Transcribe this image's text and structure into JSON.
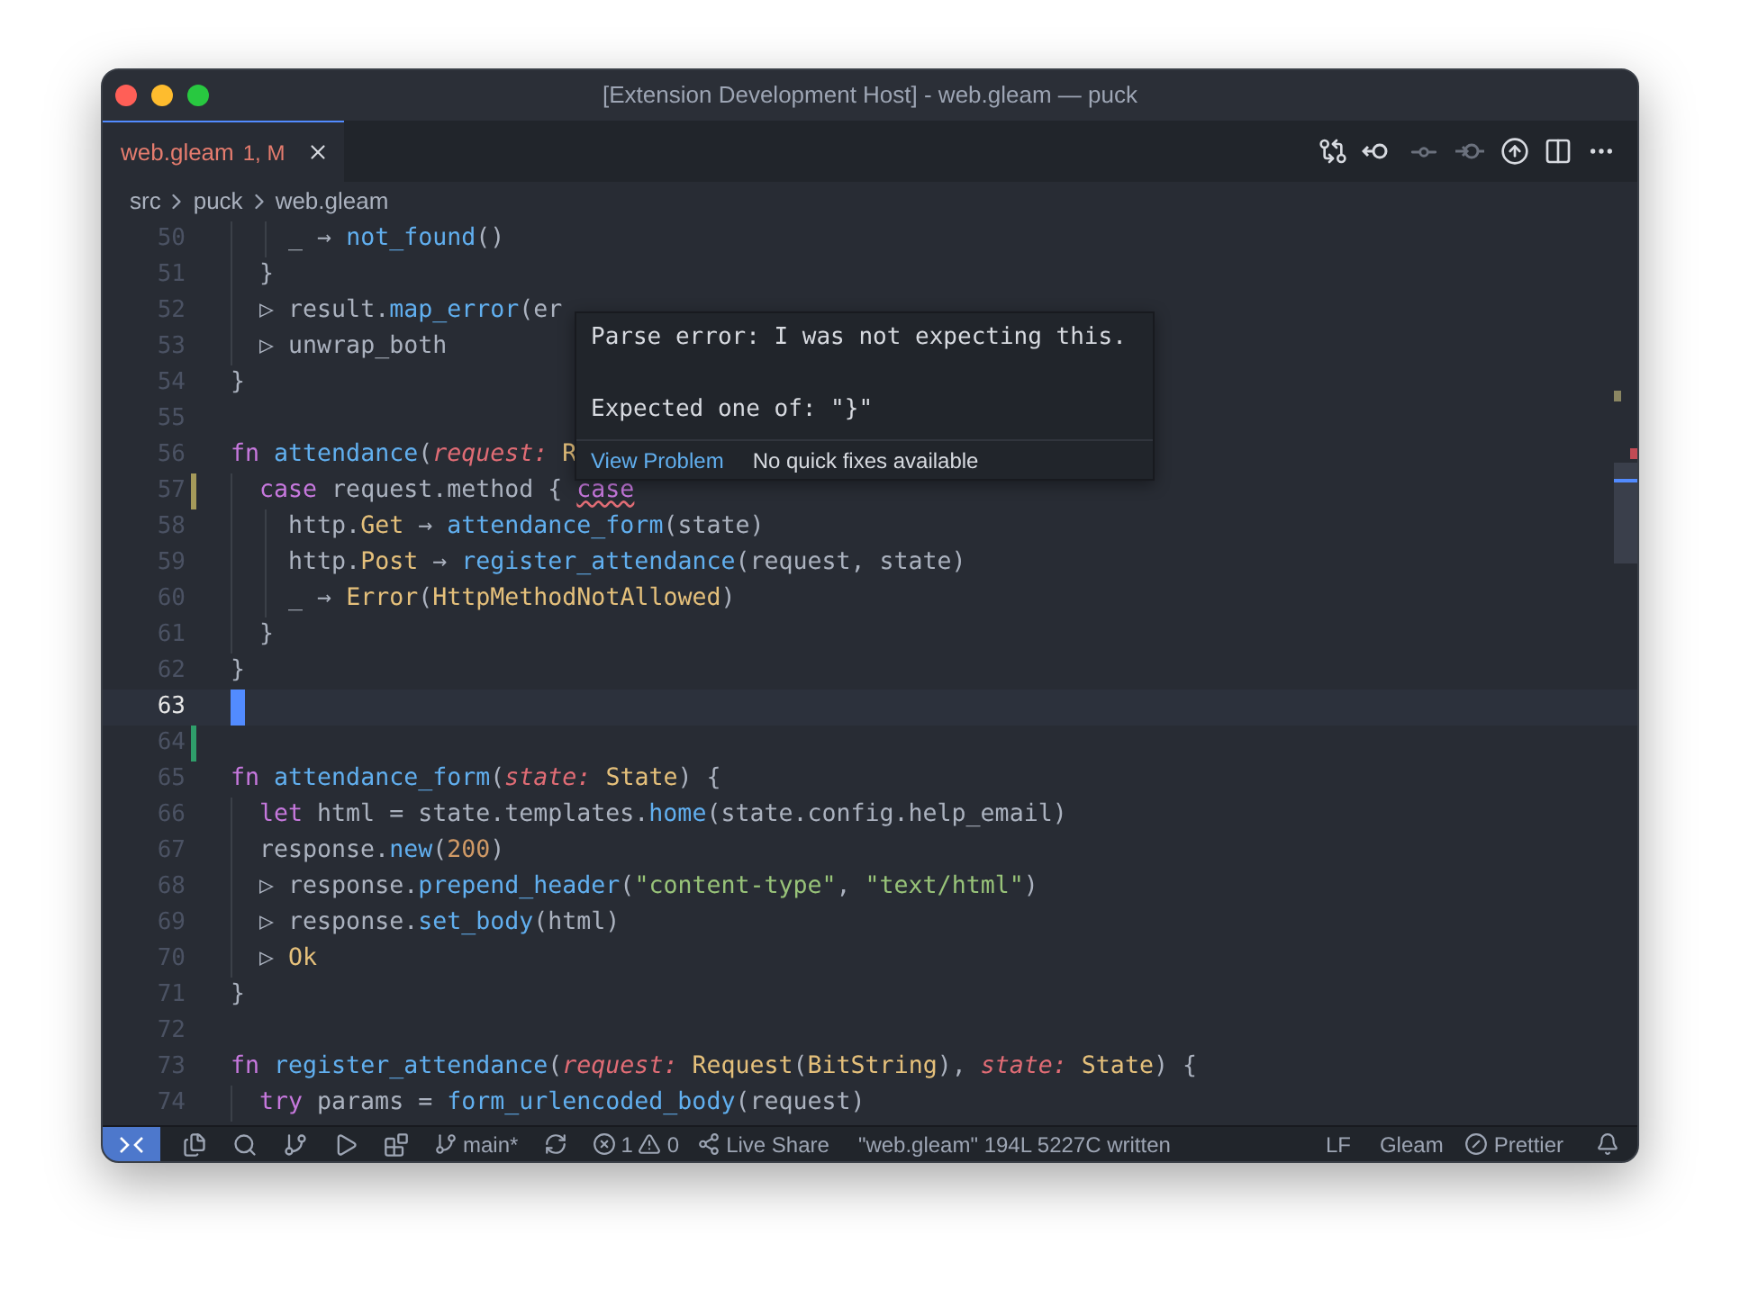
{
  "window": {
    "title": "[Extension Development Host] - web.gleam — puck"
  },
  "tabs": [
    {
      "label": "web.gleam",
      "status": "1, M",
      "selected": true,
      "error": true
    }
  ],
  "editor_actions": [
    {
      "disabled": false
    },
    {
      "disabled": false
    },
    {
      "disabled": true
    },
    {
      "disabled": true
    },
    {
      "disabled": false
    },
    {
      "disabled": false
    },
    {
      "disabled": false
    }
  ],
  "breadcrumbs": [
    "src",
    "puck",
    "web.gleam"
  ],
  "lines": [
    {
      "number": "50",
      "current": false,
      "kind": "plain",
      "tokens": [
        {
          "t": "    _ ",
          "kind": "plain"
        },
        {
          "t": "→",
          "kind": "ligature"
        },
        {
          "t": " not_found",
          "kind": "function"
        },
        {
          "t": "()",
          "kind": "plain"
        }
      ]
    },
    {
      "number": "51",
      "current": false,
      "kind": "plain",
      "tokens": [
        {
          "t": "  }",
          "kind": "plain"
        }
      ]
    },
    {
      "number": "52",
      "current": false,
      "kind": "plain",
      "tokens": [
        {
          "t": "  ▷",
          "kind": "ligature"
        },
        {
          "t": " result.",
          "kind": "plain"
        },
        {
          "t": "map_error",
          "kind": "function"
        },
        {
          "t": "(er",
          "kind": "plain"
        }
      ]
    },
    {
      "number": "53",
      "current": false,
      "kind": "plain",
      "tokens": [
        {
          "t": "  ▷",
          "kind": "ligature"
        },
        {
          "t": " unwrap_both",
          "kind": "plain"
        }
      ]
    },
    {
      "number": "54",
      "current": false,
      "kind": "plain",
      "tokens": [
        {
          "t": "}",
          "kind": "plain"
        }
      ]
    },
    {
      "number": "55",
      "current": false,
      "kind": "plain"
    },
    {
      "number": "56",
      "current": false,
      "kind": "plain",
      "tokens": [
        {
          "t": "fn ",
          "kind": "keyword"
        },
        {
          "t": "attendance",
          "kind": "function"
        },
        {
          "t": "(",
          "kind": "plain"
        },
        {
          "t": "request: ",
          "kind": "parameter"
        },
        {
          "t": "R",
          "kind": "type"
        }
      ]
    },
    {
      "number": "57",
      "current": false,
      "kind": "modified",
      "tokens": [
        {
          "t": "  case",
          "kind": "keyword"
        },
        {
          "t": " request.method { ",
          "kind": "plain"
        },
        {
          "t": "case",
          "kind": "error"
        }
      ]
    },
    {
      "number": "58",
      "current": false,
      "kind": "plain",
      "tokens": [
        {
          "t": "    http.",
          "kind": "plain"
        },
        {
          "t": "Get ",
          "kind": "type"
        },
        {
          "t": "→",
          "kind": "ligature"
        },
        {
          "t": " attendance_form",
          "kind": "function"
        },
        {
          "t": "(state)",
          "kind": "plain"
        }
      ]
    },
    {
      "number": "59",
      "current": false,
      "kind": "plain",
      "tokens": [
        {
          "t": "    http.",
          "kind": "plain"
        },
        {
          "t": "Post ",
          "kind": "type"
        },
        {
          "t": "→",
          "kind": "ligature"
        },
        {
          "t": " register_attendance",
          "kind": "function"
        },
        {
          "t": "(request, state)",
          "kind": "plain"
        }
      ]
    },
    {
      "number": "60",
      "current": false,
      "kind": "plain",
      "tokens": [
        {
          "t": "    _ ",
          "kind": "plain"
        },
        {
          "t": "→",
          "kind": "ligature"
        },
        {
          "t": " Error",
          "kind": "type"
        },
        {
          "t": "(",
          "kind": "plain"
        },
        {
          "t": "HttpMethodNotAllowed",
          "kind": "type"
        },
        {
          "t": ")",
          "kind": "plain"
        }
      ]
    },
    {
      "number": "61",
      "current": false,
      "kind": "plain",
      "tokens": [
        {
          "t": "  }",
          "kind": "plain"
        }
      ]
    },
    {
      "number": "62",
      "current": false,
      "kind": "plain",
      "tokens": [
        {
          "t": "}",
          "kind": "plain"
        }
      ]
    },
    {
      "number": "63",
      "current": true,
      "kind": "plain"
    },
    {
      "number": "64",
      "current": false,
      "kind": "added"
    },
    {
      "number": "65",
      "current": false,
      "kind": "plain",
      "tokens": [
        {
          "t": "fn ",
          "kind": "keyword"
        },
        {
          "t": "attendance_form",
          "kind": "function"
        },
        {
          "t": "(",
          "kind": "plain"
        },
        {
          "t": "state: ",
          "kind": "parameter"
        },
        {
          "t": "State",
          "kind": "type"
        },
        {
          "t": ") {",
          "kind": "plain"
        }
      ]
    },
    {
      "number": "66",
      "current": false,
      "kind": "plain",
      "tokens": [
        {
          "t": "  let",
          "kind": "keyword"
        },
        {
          "t": " html = state.templates.",
          "kind": "plain"
        },
        {
          "t": "home",
          "kind": "function"
        },
        {
          "t": "(state.config.help_email)",
          "kind": "plain"
        }
      ]
    },
    {
      "number": "67",
      "current": false,
      "kind": "plain",
      "tokens": [
        {
          "t": "  response.",
          "kind": "plain"
        },
        {
          "t": "new",
          "kind": "function"
        },
        {
          "t": "(",
          "kind": "plain"
        },
        {
          "t": "200",
          "kind": "number"
        },
        {
          "t": ")",
          "kind": "plain"
        }
      ]
    },
    {
      "number": "68",
      "current": false,
      "kind": "plain",
      "tokens": [
        {
          "t": "  ▷",
          "kind": "ligature"
        },
        {
          "t": " response.",
          "kind": "plain"
        },
        {
          "t": "prepend_header",
          "kind": "function"
        },
        {
          "t": "(",
          "kind": "plain"
        },
        {
          "t": "\"content-type\"",
          "kind": "string"
        },
        {
          "t": ", ",
          "kind": "plain"
        },
        {
          "t": "\"text/html\"",
          "kind": "string"
        },
        {
          "t": ")",
          "kind": "plain"
        }
      ]
    },
    {
      "number": "69",
      "current": false,
      "kind": "plain",
      "tokens": [
        {
          "t": "  ▷",
          "kind": "ligature"
        },
        {
          "t": " response.",
          "kind": "plain"
        },
        {
          "t": "set_body",
          "kind": "function"
        },
        {
          "t": "(html)",
          "kind": "plain"
        }
      ]
    },
    {
      "number": "70",
      "current": false,
      "kind": "plain",
      "tokens": [
        {
          "t": "  ▷",
          "kind": "ligature"
        },
        {
          "t": " Ok",
          "kind": "type"
        }
      ]
    },
    {
      "number": "71",
      "current": false,
      "kind": "plain",
      "tokens": [
        {
          "t": "}",
          "kind": "plain"
        }
      ]
    },
    {
      "number": "72",
      "current": false,
      "kind": "plain"
    },
    {
      "number": "73",
      "current": false,
      "kind": "plain",
      "tokens": [
        {
          "t": "fn ",
          "kind": "keyword"
        },
        {
          "t": "register_attendance",
          "kind": "function"
        },
        {
          "t": "(",
          "kind": "plain"
        },
        {
          "t": "request: ",
          "kind": "parameter"
        },
        {
          "t": "Request",
          "kind": "type"
        },
        {
          "t": "(",
          "kind": "plain"
        },
        {
          "t": "BitString",
          "kind": "type"
        },
        {
          "t": "), ",
          "kind": "plain"
        },
        {
          "t": "state: ",
          "kind": "parameter"
        },
        {
          "t": "State",
          "kind": "type"
        },
        {
          "t": ") {",
          "kind": "plain"
        }
      ]
    },
    {
      "number": "74",
      "current": false,
      "kind": "plain",
      "tokens": [
        {
          "t": "  try",
          "kind": "keyword"
        },
        {
          "t": " params = ",
          "kind": "plain"
        },
        {
          "t": "form_urlencoded_body",
          "kind": "function"
        },
        {
          "t": "(request)",
          "kind": "plain"
        }
      ]
    }
  ],
  "hover": {
    "message_lines": [
      "Parse error: I was not expecting this.",
      "Expected one of: \"}\""
    ],
    "link": "View Problem",
    "note": "No quick fixes available"
  },
  "status_bar": {
    "branch": "main*",
    "errors": "1",
    "warnings": "0",
    "live_share": "Live Share",
    "message": "\"web.gleam\" 194L 5227C written",
    "eol": "LF",
    "language": "Gleam",
    "formatter": "Prettier"
  }
}
